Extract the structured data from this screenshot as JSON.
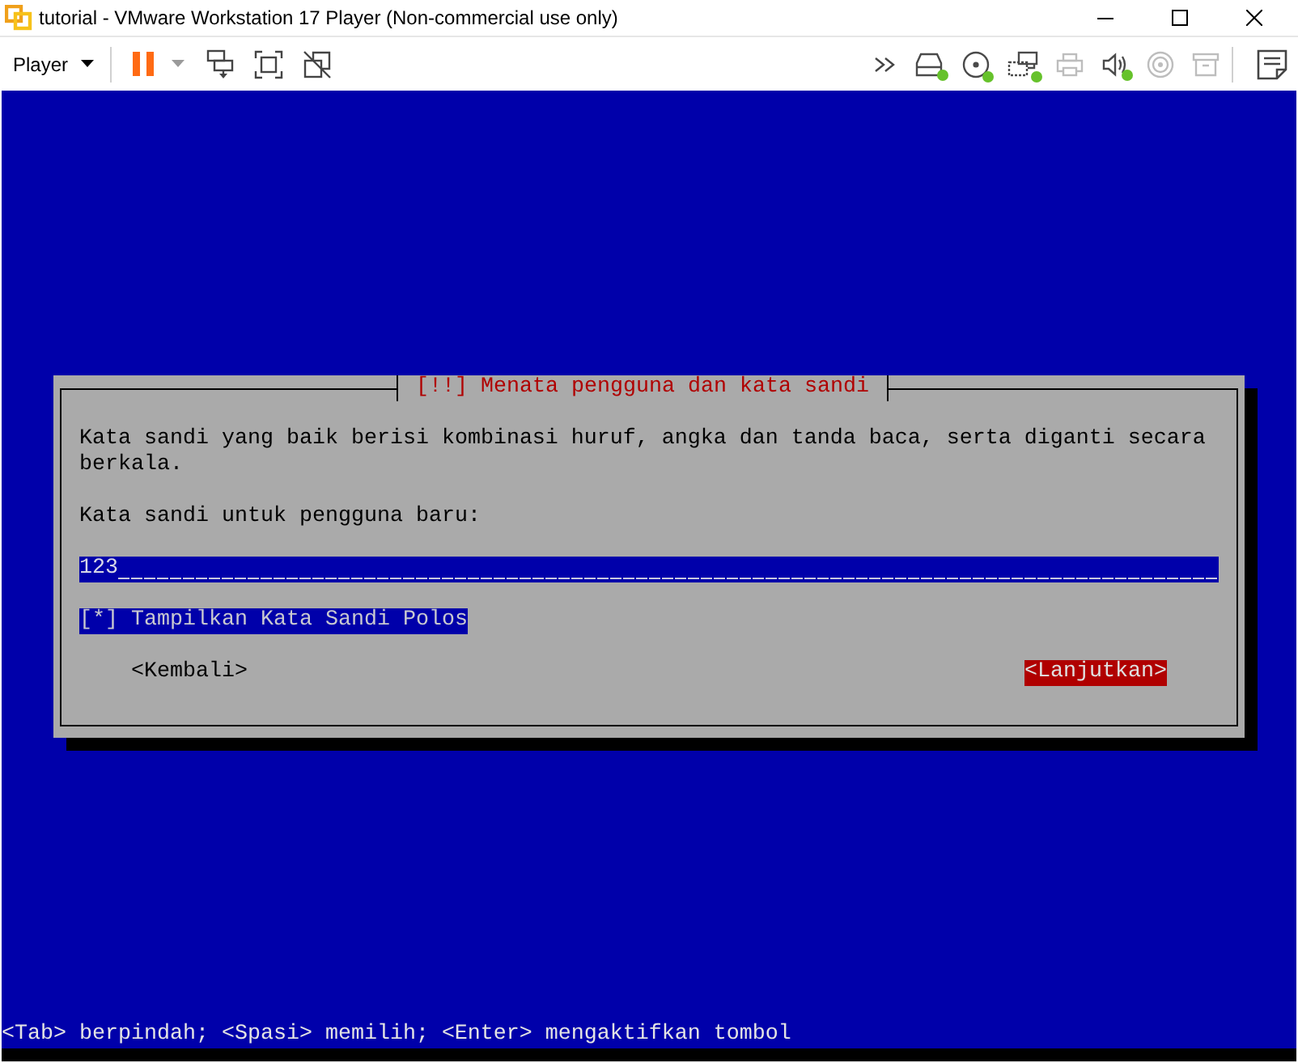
{
  "window": {
    "title": "tutorial - VMware Workstation 17 Player (Non-commercial use only)"
  },
  "toolbar": {
    "menu": "Player",
    "devices": [
      {
        "kind": "disk",
        "connected": true
      },
      {
        "kind": "cd",
        "connected": true
      },
      {
        "kind": "network",
        "connected": true
      },
      {
        "kind": "printer",
        "connected": false
      },
      {
        "kind": "sound",
        "connected": true
      },
      {
        "kind": "camera",
        "connected": false
      },
      {
        "kind": "storage",
        "connected": false
      }
    ]
  },
  "installer": {
    "dialog": {
      "title": "[!!] Menata pengguna dan kata sandi",
      "description": "Kata sandi yang baik berisi kombinasi huruf, angka dan tanda baca, serta diganti secara berkala.",
      "prompt": "Kata sandi untuk pengguna baru:",
      "password_field": {
        "value": "123"
      },
      "checkbox": {
        "box": "[*]",
        "label": "Tampilkan Kata Sandi Polos",
        "checked": true
      },
      "buttons": [
        {
          "label": "<Kembali>",
          "focused": false
        },
        {
          "label": "<Lanjutkan>",
          "focused": true
        }
      ]
    },
    "status_bar": "<Tab> berpindah; <Spasi> memilih; <Enter> mengaktifkan tombol"
  }
}
